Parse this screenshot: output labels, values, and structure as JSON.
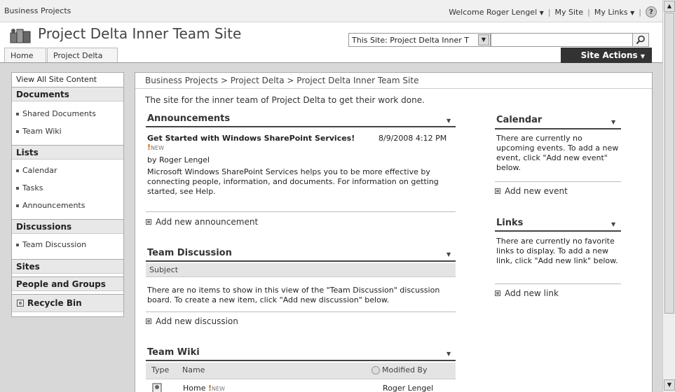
{
  "topbar": {
    "site_crumb": "Business Projects",
    "welcome": "Welcome Roger Lengel",
    "my_site": "My Site",
    "my_links": "My Links",
    "sep": "|",
    "help": "?"
  },
  "header": {
    "site_title": "Project Delta Inner Team Site",
    "search_scope": "This Site: Project Delta Inner T",
    "search_value": "",
    "tabs": [
      {
        "label": "Home"
      },
      {
        "label": "Project Delta"
      }
    ],
    "site_actions": "Site Actions"
  },
  "leftnav": {
    "view_all": "View All Site Content",
    "sections": [
      {
        "heading": "Documents",
        "items": [
          "Shared Documents",
          "Team Wiki"
        ]
      },
      {
        "heading": "Lists",
        "items": [
          "Calendar",
          "Tasks",
          "Announcements"
        ]
      },
      {
        "heading": "Discussions",
        "items": [
          "Team Discussion"
        ]
      },
      {
        "heading": "Sites",
        "items": []
      },
      {
        "heading": "People and Groups",
        "items": []
      }
    ],
    "recycle_bin": "Recycle Bin"
  },
  "main": {
    "breadcrumb": "Business Projects > Project Delta > Project Delta Inner Team Site",
    "description": "The site for the inner team of Project Delta to get their work done.",
    "announcements": {
      "title": "Announcements",
      "item_title": "Get Started with Windows SharePoint Services!",
      "new_badge": "NEW",
      "item_date": "8/9/2008 4:12 PM",
      "item_author": "by Roger Lengel",
      "item_body": "Microsoft Windows SharePoint Services helps you to be more effective by connecting people, information, and documents. For information on getting started, see Help.",
      "add_link": "Add new announcement"
    },
    "team_discussion": {
      "title": "Team Discussion",
      "column": "Subject",
      "empty_text": "There are no items to show in this view of the \"Team Discussion\" discussion board. To create a new item, click \"Add new discussion\" below.",
      "add_link": "Add new discussion"
    },
    "team_wiki": {
      "title": "Team Wiki",
      "columns": [
        "Type",
        "Name",
        "Modified By"
      ],
      "rows": [
        {
          "name": "Home",
          "new_badge": "NEW",
          "modified_by": "Roger Lengel"
        }
      ]
    },
    "calendar": {
      "title": "Calendar",
      "empty_text": "There are currently no upcoming events. To add a new event, click \"Add new event\" below.",
      "add_link": "Add new event"
    },
    "links": {
      "title": "Links",
      "empty_text": "There are currently no favorite links to display. To add a new link, click \"Add new link\" below.",
      "add_link": "Add new link"
    }
  },
  "icons": {
    "logo": "site-logo-icon",
    "search": "search-icon",
    "help": "help-icon",
    "recycle": "recycle-bin-icon"
  },
  "colors": {
    "site_actions_bg": "#333333",
    "body_bg": "#d8d8d8"
  }
}
